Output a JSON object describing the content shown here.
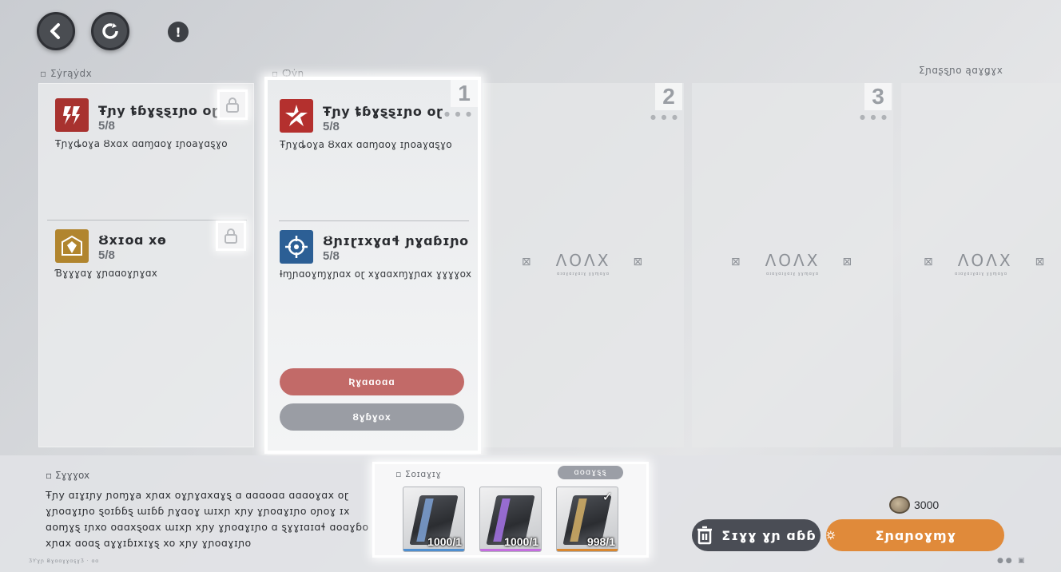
{
  "topbar": {
    "back_icon": "chevron-left-icon",
    "reset_icon": "refresh-icon",
    "info_label": "!"
  },
  "sections": {
    "current_label": "Σẏrąẏdx",
    "new_label": "Ѻẏɲ",
    "preset_label": "Ʃɲɑʂȿɲo ąɑɣǥɣx"
  },
  "current_buffs": [
    {
      "name": "Ŧɲy ȶɓɣȿȿɪɲo oɽ",
      "level": "5/8",
      "desc": "Ŧɲɣȡoɣa Ȣxɑx ɑɑɱɑoɣ ɪɲoaɣɑȿɣo",
      "color": "#a8322f",
      "icon": "lightning-icon",
      "locked": true
    },
    {
      "name": "Ȣxɪoɑ xɵ",
      "level": "5/8",
      "desc": "Ɓɣɣɣɑɣ ɣɲɑɑoɣɲɣɑx",
      "color": "#b1852e",
      "icon": "shield-icon",
      "locked": true
    }
  ],
  "new_buffs": [
    {
      "name": "Ŧɲy ȶɓɣȿȿɪɲo oɽ",
      "level": "5/8",
      "desc": "Ŧɲɣȡoɣa Ȣxɑx ɑɑɱɑoɣ ɪɲoaɣɑȿɣo",
      "color": "#b4302e",
      "icon": "star-burst-icon"
    },
    {
      "name": "Ȣɲɪɽɪxɣɑɬ ɲɣɑɓɪɲo",
      "level": "5/8",
      "desc": "Ɨɱɲɑoɣɱɣɲɑx oɽ xɣɑɑxɱɣɲɑx ɣɣɣɣox",
      "color": "#2c5f95",
      "icon": "crosshair-icon"
    }
  ],
  "buttons": {
    "replace": "Ʀɣɑɑoɑɑ",
    "cancel": "Ȣɣɓɣox",
    "clear_all": "Ʃɪɣɣ ɣɲ ɑɓɓ",
    "upgrade": "Ʃɲɑɲoɣɱɣ"
  },
  "slots": [
    {
      "number": "1"
    },
    {
      "number": "2",
      "empty_label": "ɅOɅX",
      "empty_sub": "ɑɪɑɣɑɪɣɑɪɣ ɣɣɱɑɣɑ"
    },
    {
      "number": "3",
      "empty_label": "ɅOɅX",
      "empty_sub": "ɑɪɑɣɑɪɣɑɪɣ ɣɣɱɑɣɑ"
    },
    {
      "number": "",
      "empty_label": "ɅOɅX",
      "empty_sub": "ɑɪɑɣɑɪɣɑɪɣ ɣɣɱɑɣɑ"
    }
  ],
  "description": {
    "title": "Ʃɣɣɣox",
    "text": "Ŧɲy ɑɪɣɪɲy ɲoɱɣa xɲɑx oɣɲɣɑxɑɣȿ ɑ ɑɑɑoɑɑ ɑɑɑoɣɑx oɽ ɣɲoɑɣɪɲo ȿoɪɓɓȿ ɯɪɓɓ ɲɣɑoɣ ɯɪxɲ xɲy ɣɲoɑɣɪɲo oɲoɣ ɪx ɑoɱɣȿ ɪɲxo oɑɑxȿoɑx ɯɪxɲ xɲy ɣɲoɑɣɪɲo ɑ ȿɣɣɪɑɪɑɬ ɑoɑɣɓo xɲɑx ɑoɑȿ ɑɣɣɪɓɪxɪɣȿ xo xɲy ɣɲoɑɣɪɲo"
  },
  "materials": {
    "label": "Ʃoɪɑɣɪɣ",
    "stock_badge": "ɑoɑɣȿȿ",
    "items": [
      {
        "count": "1000/1",
        "bar_color": "#4f8fd0",
        "stripe": "#7ea2d6",
        "selected": false
      },
      {
        "count": "1000/1",
        "bar_color": "#c56ee0",
        "stripe": "#a673e8",
        "selected": false
      },
      {
        "count": "998/1",
        "bar_color": "#d9872f",
        "stripe": "#d6b267",
        "selected": true
      }
    ]
  },
  "cost": {
    "value": "3000",
    "icon": "coin-icon"
  },
  "footer": {
    "text": "ƷƳɣɲ ɃɣɑɑɣɣɑȿɣƷ · ɑɑ"
  }
}
